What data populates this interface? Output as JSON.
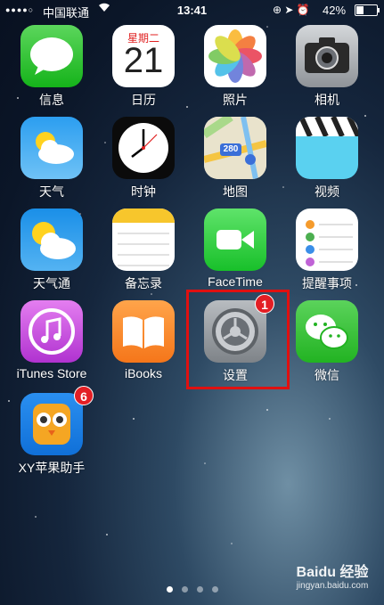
{
  "status_bar": {
    "carrier": "中国联通",
    "time": "13:41",
    "battery_percent": "42%",
    "battery_level": 0.42
  },
  "calendar": {
    "weekday": "星期二",
    "day": "21"
  },
  "maps_route": "280",
  "apps": [
    {
      "id": "messages",
      "label": "信息",
      "icon": "messages-icon"
    },
    {
      "id": "calendar",
      "label": "日历",
      "icon": "calendar-icon"
    },
    {
      "id": "photos",
      "label": "照片",
      "icon": "photos-icon"
    },
    {
      "id": "camera",
      "label": "相机",
      "icon": "camera-icon"
    },
    {
      "id": "weather",
      "label": "天气",
      "icon": "weather-icon"
    },
    {
      "id": "clock",
      "label": "时钟",
      "icon": "clock-icon"
    },
    {
      "id": "maps",
      "label": "地图",
      "icon": "maps-icon"
    },
    {
      "id": "videos",
      "label": "视频",
      "icon": "videos-icon"
    },
    {
      "id": "tianqitong",
      "label": "天气通",
      "icon": "tianqitong-icon"
    },
    {
      "id": "notes",
      "label": "备忘录",
      "icon": "notes-icon"
    },
    {
      "id": "facetime",
      "label": "FaceTime",
      "icon": "facetime-icon"
    },
    {
      "id": "reminders",
      "label": "提醒事项",
      "icon": "reminders-icon"
    },
    {
      "id": "itunes",
      "label": "iTunes Store",
      "icon": "itunes-icon"
    },
    {
      "id": "ibooks",
      "label": "iBooks",
      "icon": "ibooks-icon"
    },
    {
      "id": "settings",
      "label": "设置",
      "icon": "settings-icon",
      "badge": "1"
    },
    {
      "id": "wechat",
      "label": "微信",
      "icon": "wechat-icon"
    },
    {
      "id": "xy",
      "label": "XY苹果助手",
      "icon": "xy-assistant-icon",
      "badge": "6"
    }
  ],
  "page_indicator": {
    "pages": 4,
    "current": 1
  },
  "watermark": {
    "brand": "Baidu 经验",
    "url": "jingyan.baidu.com"
  },
  "colors": {
    "highlight": "#e01010",
    "badge": "#e31e24"
  }
}
